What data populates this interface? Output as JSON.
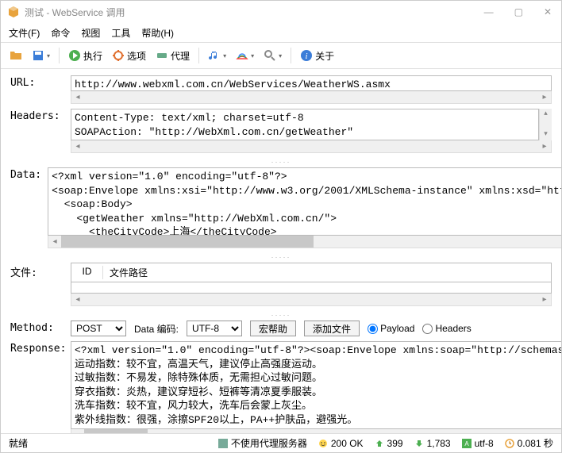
{
  "window": {
    "title": "测试 - WebService 调用"
  },
  "menu": {
    "file": "文件(F)",
    "command": "命令",
    "view": "视图",
    "tools": "工具",
    "help": "帮助(H)"
  },
  "toolbar": {
    "run": "执行",
    "options": "选项",
    "proxy": "代理",
    "about": "关于"
  },
  "labels": {
    "url": "URL:",
    "headers": "Headers:",
    "data": "Data:",
    "files": "文件:",
    "method": "Method:",
    "response": "Response:",
    "file_id": "ID",
    "file_path": "文件路径",
    "data_encoding": "Data 编码:"
  },
  "fields": {
    "url": "http://www.webxml.com.cn/WebServices/WeatherWS.asmx",
    "headers": "Content-Type: text/xml; charset=utf-8\nSOAPAction: \"http://WebXml.com.cn/getWeather\"",
    "data": "<?xml version=\"1.0\" encoding=\"utf-8\"?>\n<soap:Envelope xmlns:xsi=\"http://www.w3.org/2001/XMLSchema-instance\" xmlns:xsd=\"http:/\n  <soap:Body>\n    <getWeather xmlns=\"http://WebXml.com.cn/\">\n      <theCityCode>上海</theCityCode>\n      <theUserID></theUserID>",
    "response": "<?xml version=\"1.0\" encoding=\"utf-8\"?><soap:Envelope xmlns:soap=\"http://schemas.xmlsoa\n运动指数：较不宜，高温天气，建议停止高强度运动。\n过敏指数：不易发，除特殊体质，无需担心过敏问题。\n穿衣指数：炎热，建议穿短衫、短裤等清凉夏季服装。\n洗车指数：较不宜，风力较大，洗车后会蒙上灰尘。\n紫外线指数：很强，涂擦SPF20以上，PA++护肤品，避强光。"
  },
  "method": {
    "selected": "POST",
    "encoding": "UTF-8",
    "btn_help": "宏帮助",
    "btn_addfile": "添加文件",
    "radio_payload": "Payload",
    "radio_headers": "Headers"
  },
  "status": {
    "ready": "就绪",
    "proxy": "不使用代理服务器",
    "http": "200 OK",
    "up": "399",
    "down": "1,783",
    "enc": "utf-8",
    "time": "0.081 秒"
  }
}
